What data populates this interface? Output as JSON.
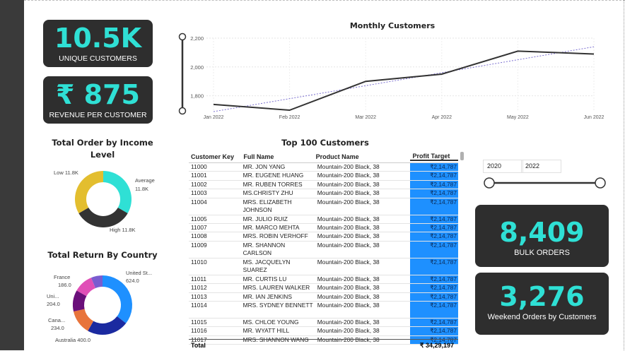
{
  "kpis": {
    "unique_customers": {
      "value": "10.5K",
      "label": "UNIQUE CUSTOMERS"
    },
    "revenue_per_customer": {
      "value": "₹ 875",
      "label": "REVENUE PER CUSTOMER"
    },
    "bulk_orders": {
      "value": "8,409",
      "label": "BULK ORDERS"
    },
    "weekend_orders": {
      "value": "3,276",
      "label": "Weekend Orders by Customers"
    }
  },
  "line_chart": {
    "title": "Monthly Customers",
    "categories": [
      "Jan 2022",
      "Feb 2022",
      "Mar 2022",
      "Apr 2022",
      "May 2022",
      "Jun 2022"
    ],
    "values": [
      1740,
      1700,
      1900,
      1950,
      2110,
      2090
    ],
    "trend": [
      1690,
      1780,
      1870,
      1960,
      2050,
      2140
    ],
    "yticks": [
      "1,800",
      "2,000",
      "2,200"
    ],
    "ylim": [
      1700,
      2200
    ]
  },
  "donut_income": {
    "title": "Total Order by Income Level",
    "slices": [
      {
        "label": "Average",
        "value_label": "11.8K",
        "value": 11.8,
        "color": "#2fe0d5"
      },
      {
        "label": "High",
        "value_label": "11.8K",
        "value": 11.8,
        "color": "#333333"
      },
      {
        "label": "Low",
        "value_label": "11.8K",
        "value": 11.8,
        "color": "#e3be2f"
      }
    ],
    "labels": {
      "average_name": "Average",
      "average_val": "11.8K",
      "high": "High 11.8K",
      "low": "Low 11.8K"
    }
  },
  "donut_country": {
    "title": "Total Return By Country",
    "slices": [
      {
        "label": "United St...",
        "value": 624.0,
        "color": "#1e90ff"
      },
      {
        "label": "Australia",
        "value": 400.0,
        "color": "#1b2aa0"
      },
      {
        "label": "Cana...",
        "value": 234.0,
        "color": "#e8743b"
      },
      {
        "label": "Uni...",
        "value": 204.0,
        "color": "#6a0f7a"
      },
      {
        "label": "France",
        "value": 186.0,
        "color": "#e04fb7"
      },
      {
        "label": "Other",
        "value": 110.0,
        "color": "#7a5ccf"
      }
    ],
    "labels": {
      "us_name": "United St...",
      "us_val": "624.0",
      "france_name": "France",
      "france_val": "186.0",
      "uni_name": "Uni...",
      "uni_val": "204.0",
      "cana_name": "Cana...",
      "cana_val": "234.0",
      "aus": "Australia 400.0"
    }
  },
  "table": {
    "title": "Top 100 Customers",
    "columns": [
      "Customer Key",
      "Full Name",
      "Product Name",
      "Profit Target"
    ],
    "rows": [
      [
        "11000",
        "MR. JON YANG",
        "Mountain-200 Black, 38",
        "₹2,14,787"
      ],
      [
        "11001",
        "MR. EUGENE HUANG",
        "Mountain-200 Black, 38",
        "₹2,14,787"
      ],
      [
        "11002",
        "MR. RUBEN TORRES",
        "Mountain-200 Black, 38",
        "₹2,14,787"
      ],
      [
        "11003",
        "MS.CHRISTY ZHU",
        "Mountain-200 Black, 38",
        "₹2,14,787"
      ],
      [
        "11004",
        "MRS. ELIZABETH JOHNSON",
        "Mountain-200 Black, 38",
        "₹2,14,787"
      ],
      [
        "11005",
        "MR. JULIO RUIZ",
        "Mountain-200 Black, 38",
        "₹2,14,787"
      ],
      [
        "11007",
        "MR. MARCO MEHTA",
        "Mountain-200 Black, 38",
        "₹2,14,787"
      ],
      [
        "11008",
        "MRS. ROBIN VERHOFF",
        "Mountain-200 Black, 38",
        "₹2,14,787"
      ],
      [
        "11009",
        "MR. SHANNON CARLSON",
        "Mountain-200 Black, 38",
        "₹2,14,787"
      ],
      [
        "11010",
        "MS. JACQUELYN SUAREZ",
        "Mountain-200 Black, 38",
        "₹2,14,787"
      ],
      [
        "11011",
        "MR. CURTIS LU",
        "Mountain-200 Black, 38",
        "₹2,14,787"
      ],
      [
        "11012",
        "MRS. LAUREN WALKER",
        "Mountain-200 Black, 38",
        "₹2,14,787"
      ],
      [
        "11013",
        "MR. IAN JENKINS",
        "Mountain-200 Black, 38",
        "₹2,14,787"
      ],
      [
        "11014",
        "MRS. SYDNEY BENNETT",
        "Mountain-200 Black, 38",
        "₹2,14,787"
      ],
      [
        "11015",
        "MS. CHLOE YOUNG",
        "Mountain-200 Black, 38",
        "₹2,14,787"
      ],
      [
        "11016",
        "MR. WYATT HILL",
        "Mountain-200 Black, 38",
        "₹2,14,787"
      ],
      [
        "11017",
        "MRS. SHANNON WANG",
        "Mountain-200 Black, 38",
        "₹2,14,787"
      ]
    ],
    "total_label": "Total",
    "total_value": "₹ 34,29,197"
  },
  "slicer": {
    "start": "2020",
    "end": "2022"
  },
  "colors": {
    "accent": "#2fe0d5",
    "card": "#2e2e2e",
    "highlight": "#1e90ff"
  }
}
